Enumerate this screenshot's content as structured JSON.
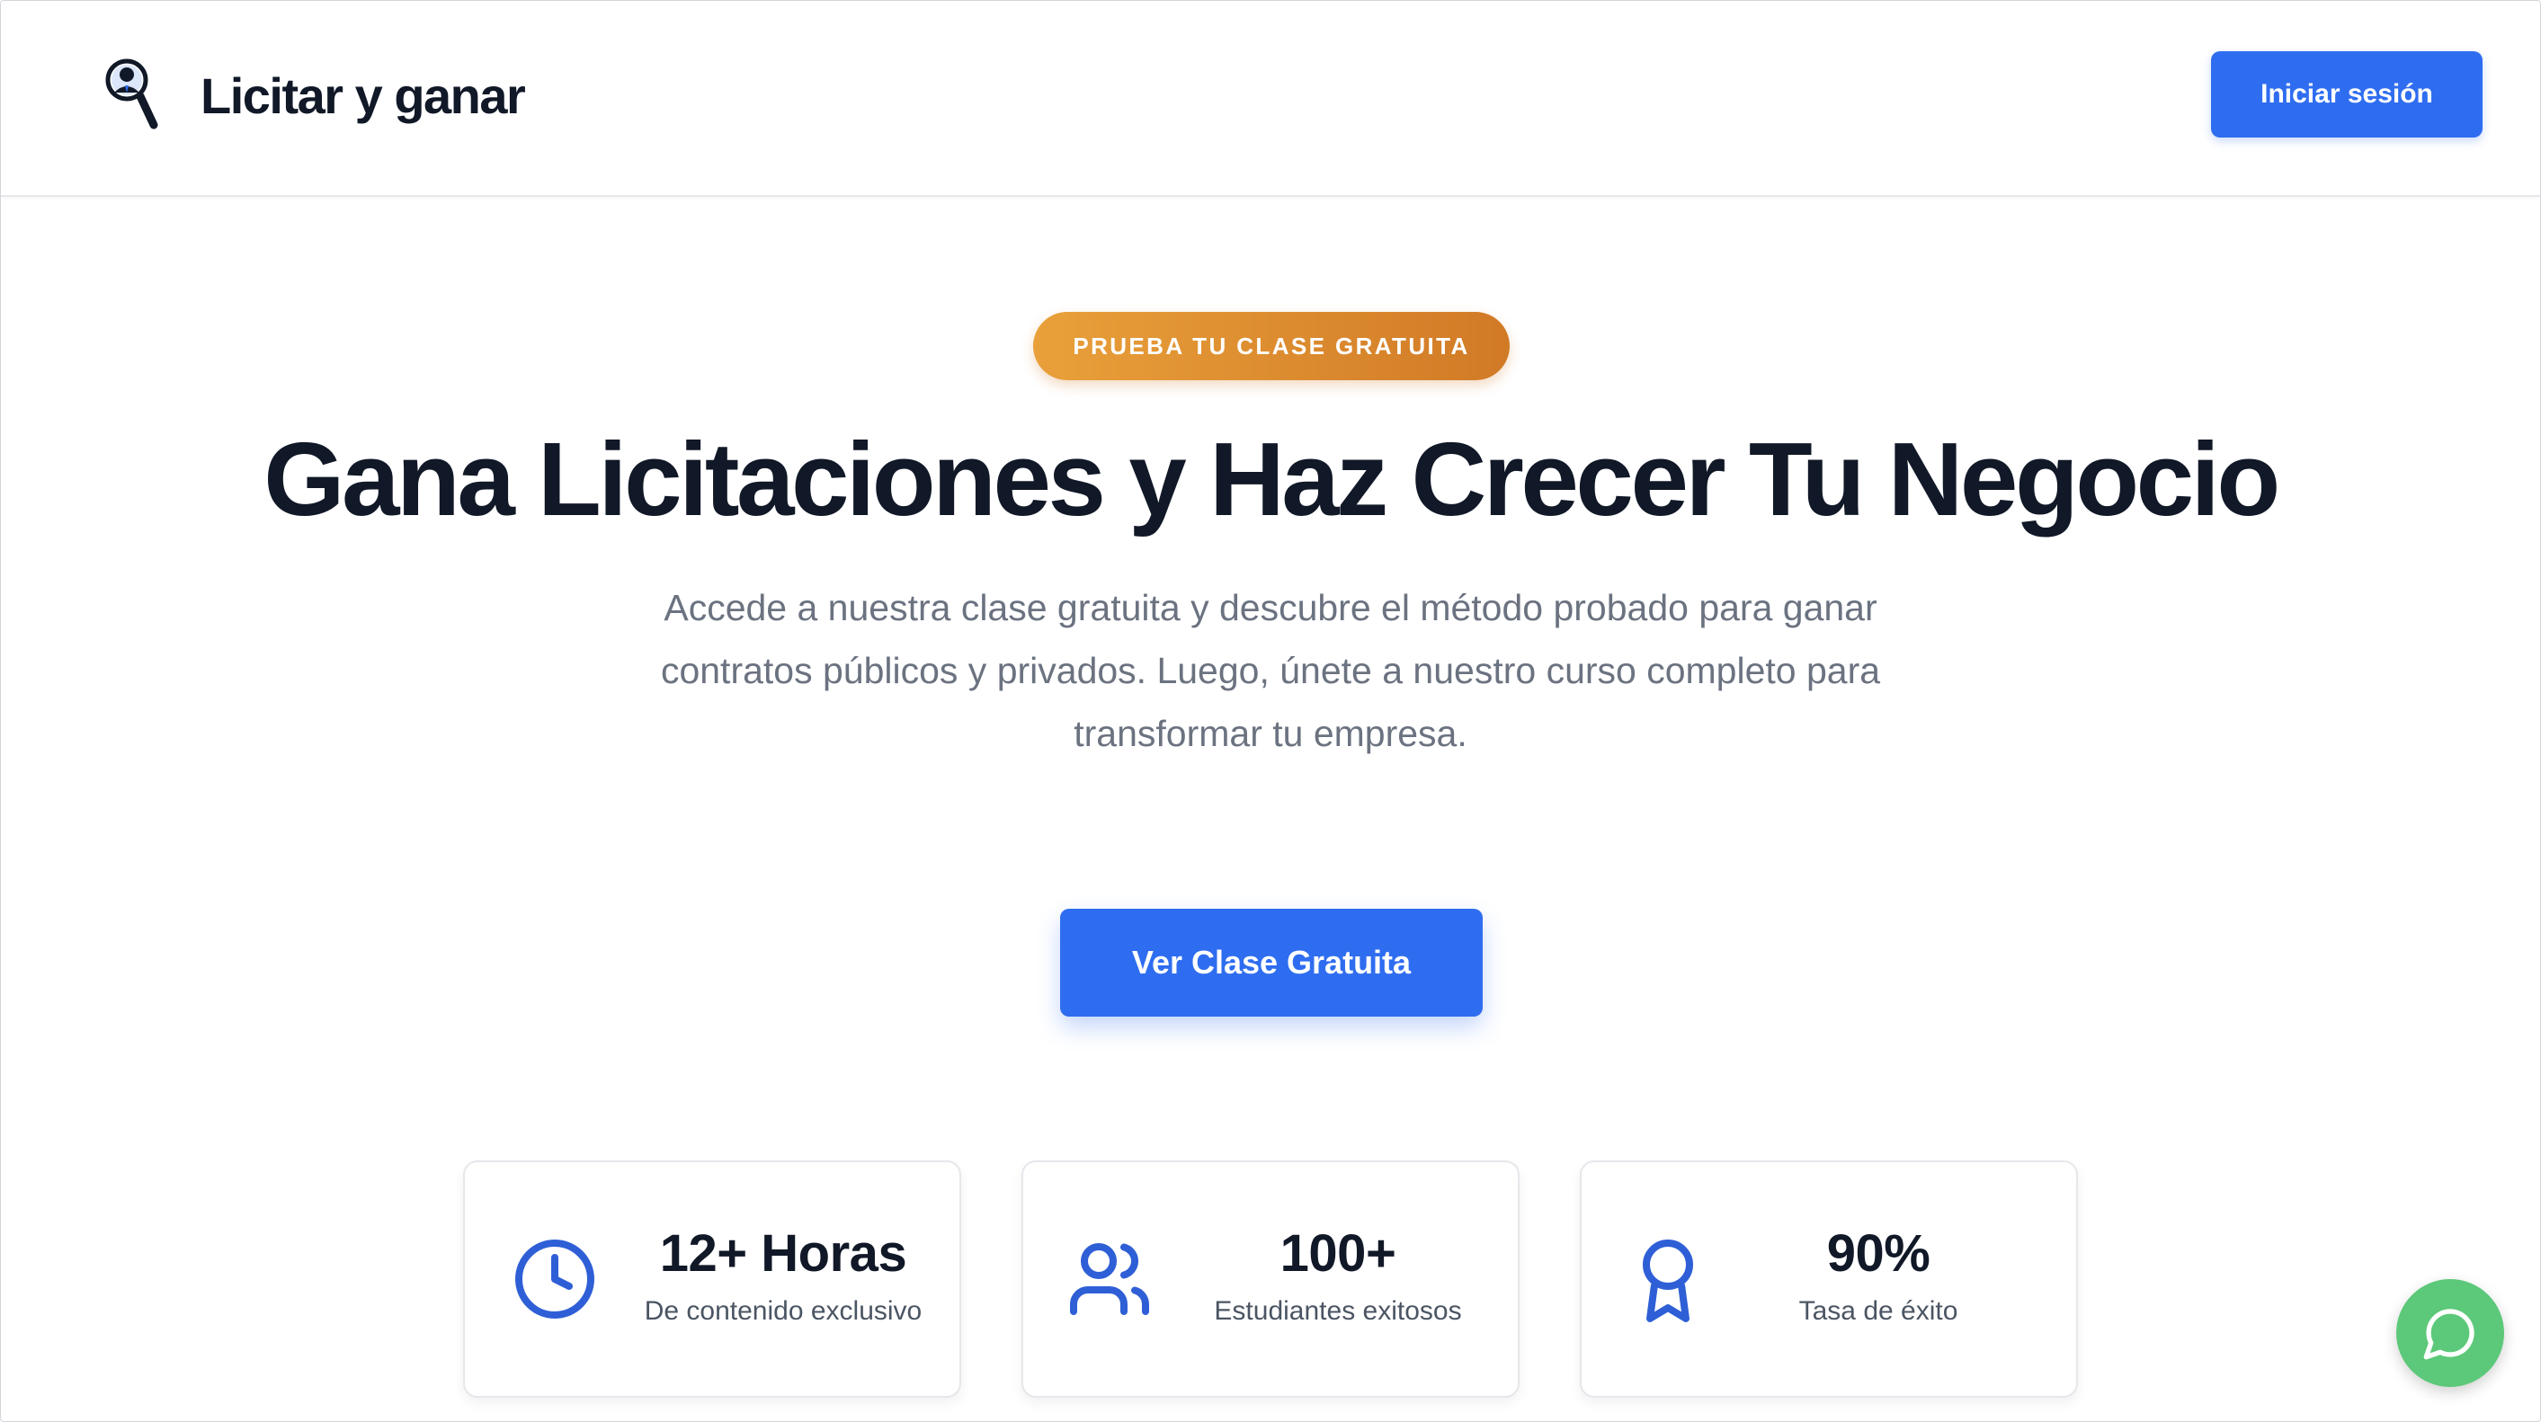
{
  "header": {
    "brand_name": "Licitar y ganar",
    "login_label": "Iniciar sesión"
  },
  "hero": {
    "badge": "PRUEBA TU CLASE GRATUITA",
    "title": "Gana Licitaciones y Haz Crecer Tu Negocio",
    "subtitle": "Accede a nuestra clase gratuita y descubre el método probado para ganar contratos públicos y privados. Luego, únete a nuestro curso completo para transformar tu empresa.",
    "cta_label": "Ver Clase Gratuita"
  },
  "stats": [
    {
      "value": "12+ Horas",
      "label": "De contenido exclusivo",
      "icon": "clock-icon"
    },
    {
      "value": "100+",
      "label": "Estudiantes exitosos",
      "icon": "users-icon"
    },
    {
      "value": "90%",
      "label": "Tasa de éxito",
      "icon": "award-icon"
    }
  ],
  "chat": {
    "icon": "chat-bubble-icon"
  },
  "colors": {
    "primary": "#2f6df0",
    "badge_start": "#e9a03a",
    "badge_end": "#d17a26",
    "chat_green": "#5cc879",
    "text_dark": "#111827",
    "text_muted": "#6b7280"
  }
}
